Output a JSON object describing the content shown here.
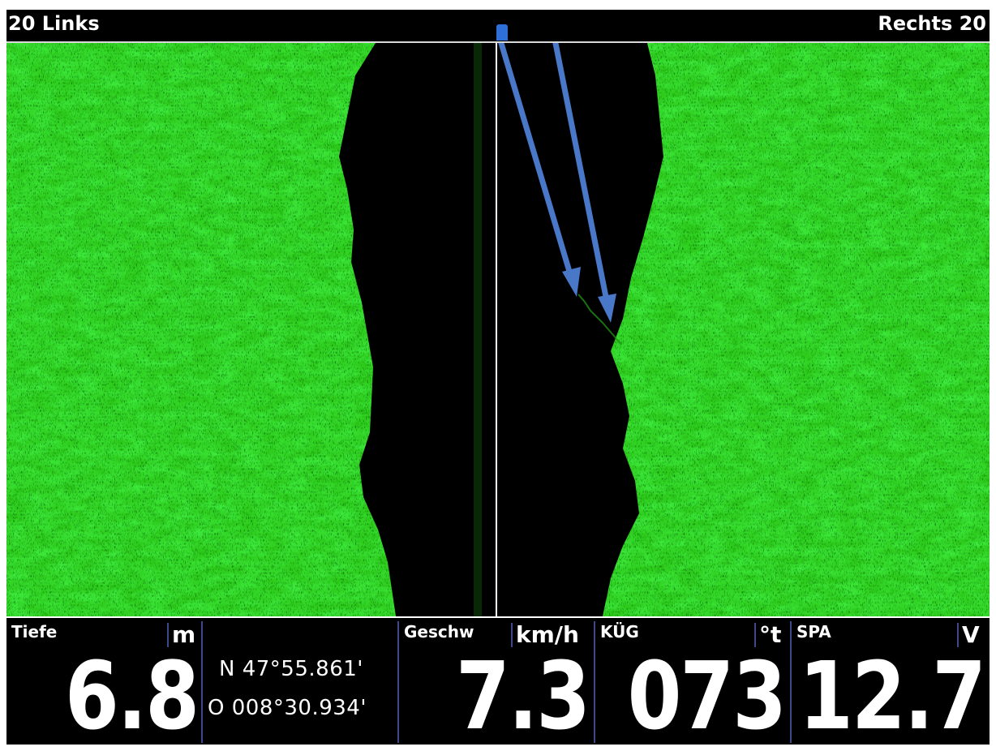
{
  "scale": {
    "left_label": "20 Links",
    "right_label": "Rechts 20"
  },
  "colors": {
    "sonar_return": "#33dd22",
    "sonar_background": "#000000",
    "annotation_arrow": "#4a78c8",
    "separator": "#3c4a8c"
  },
  "readouts": {
    "depth": {
      "label": "Tiefe",
      "unit": "m",
      "value": "6.8"
    },
    "position": {
      "lat": "N 47°55.861'",
      "lon": "O 008°30.934'"
    },
    "speed": {
      "label": "Geschw",
      "unit": "km/h",
      "value": "7.3"
    },
    "course": {
      "label": "KÜG",
      "unit": "°t",
      "value": "073"
    },
    "voltage": {
      "label": "SPA",
      "unit": "V",
      "value": "12.7"
    }
  }
}
